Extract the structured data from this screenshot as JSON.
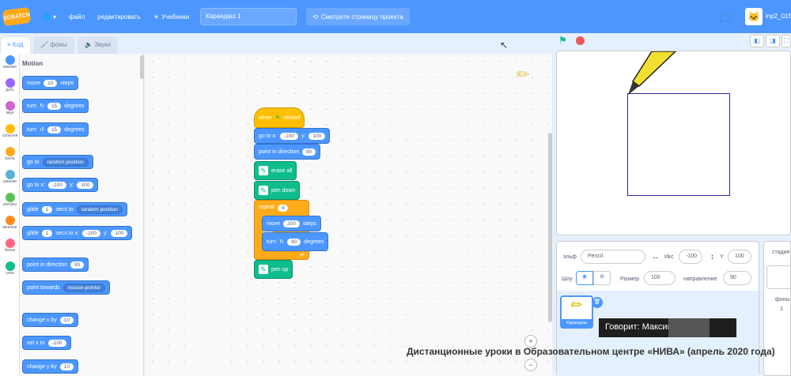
{
  "topbar": {
    "logo_text": "SCRATCH",
    "globe_icon": "globe-icon",
    "file_menu": "файл",
    "edit_menu": "редактировать",
    "tutorials": "Учебники",
    "project_title": "Карандаш 1",
    "see_project": "Смотрите страницу проекта",
    "username": "inp2_015"
  },
  "tabs": {
    "code": "Код",
    "costumes": "фоны",
    "sounds": "Звуки"
  },
  "categories": [
    {
      "label": "ижение",
      "color": "#4c97ff"
    },
    {
      "label": "дать",
      "color": "#9966ff"
    },
    {
      "label": "звук",
      "color": "#cf63cf"
    },
    {
      "label": "события",
      "color": "#ffbf00"
    },
    {
      "label": "троль",
      "color": "#ffab19"
    },
    {
      "label": "ывание",
      "color": "#5cb1d6"
    },
    {
      "label": "раторы",
      "color": "#59c059"
    },
    {
      "label": "менные",
      "color": "#ff8c1a"
    },
    {
      "label": "блоки",
      "color": "#ff6680"
    },
    {
      "label": "учка",
      "color": "#0fbd8c"
    }
  ],
  "palette": {
    "title": "Motion",
    "b_move": "move",
    "b_move_val": "10",
    "b_move_unit": "steps",
    "b_turn_r": "turn",
    "b_turn_r_val": "15",
    "b_turn_r_unit": "degrees",
    "b_turn_l": "turn",
    "b_turn_l_val": "15",
    "b_turn_l_unit": "degrees",
    "b_goto": "go to",
    "b_goto_dd": "random position",
    "b_gotoxy": "go to x:",
    "b_gotoxy_x": "-100",
    "b_gotoxy_y_label": "y:",
    "b_gotoxy_y": "100",
    "b_glide1": "glide",
    "b_glide1_val": "1",
    "b_glide1_mid": "secs to",
    "b_glide1_dd": "random position",
    "b_glide2": "glide",
    "b_glide2_val": "1",
    "b_glide2_mid": "secs to x:",
    "b_glide2_x": "-100",
    "b_glide2_y_label": "y:",
    "b_glide2_y": "100",
    "b_point": "point in direction",
    "b_point_val": "90",
    "b_towards": "point towards",
    "b_towards_dd": "mouse-pointer",
    "b_changex": "change x by",
    "b_changex_val": "10",
    "b_setx": "set x to",
    "b_setx_val": "-100",
    "b_changey": "change y by",
    "b_changey_val": "10"
  },
  "script": {
    "when": "when",
    "clicked": "clicked",
    "goto": "go to x:",
    "goto_x": "-100",
    "goto_y_label": "y:",
    "goto_y": "100",
    "point": "point in direction",
    "point_val": "90",
    "erase": "erase all",
    "pendown": "pen down",
    "repeat": "repeat",
    "repeat_val": "4",
    "move": "move",
    "move_val": "200",
    "move_unit": "steps",
    "turn": "turn",
    "turn_val": "90",
    "turn_unit": "degrees",
    "penup": "pen up"
  },
  "sprite_info": {
    "sprite_label": "эльф",
    "sprite_name": "Pencil",
    "x_label": "Икс",
    "x_val": "-100",
    "y_label": "Y",
    "y_val": "100",
    "show_label": "Шоу",
    "size_label": "Размер",
    "size_val": "100",
    "dir_label": "направление",
    "dir_val": "90",
    "thumb_name": "Карандаш"
  },
  "stage_pane": {
    "label": "стадия",
    "backdrops": "фоны",
    "count": "1"
  },
  "overlay": {
    "speaker": "Говорит: Максим"
  },
  "caption": "Дистанционные уроки в Образовательном центре «НИВА» (апрель 2020 года)",
  "colors": {
    "motion": "#4c97ff",
    "pen": "#0fbd8c",
    "control": "#ffab19",
    "events": "#ffbf00"
  }
}
